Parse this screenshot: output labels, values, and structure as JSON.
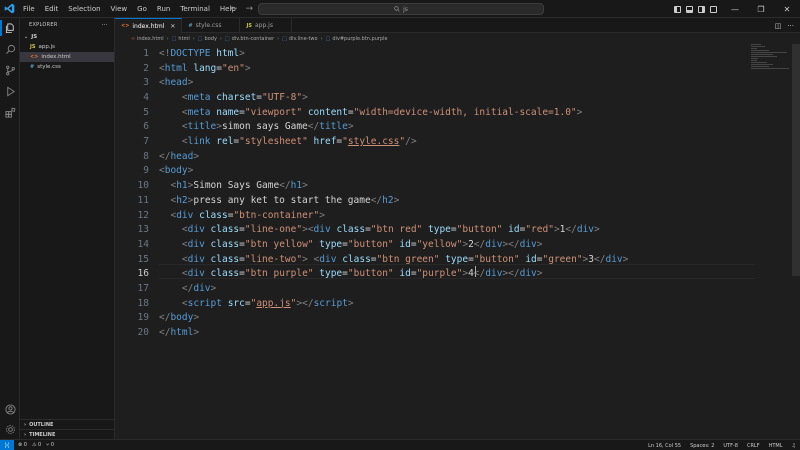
{
  "titlebar": {
    "menu": [
      "File",
      "Edit",
      "Selection",
      "View",
      "Go",
      "Run",
      "Terminal",
      "Help"
    ],
    "search_text": "js",
    "win_minimize": "—",
    "win_maximize": "❐",
    "win_close": "✕"
  },
  "sidebar": {
    "header": "EXPLORER",
    "more": "···",
    "folder": "JS",
    "files": [
      {
        "name": "app.js",
        "badge": "JS"
      },
      {
        "name": "index.html",
        "badge": "<>"
      },
      {
        "name": "style.css",
        "badge": "#"
      }
    ],
    "outline": "OUTLINE",
    "timeline": "TIMELINE"
  },
  "tabs": [
    {
      "label": "index.html",
      "badge": "<>",
      "close": "✕"
    },
    {
      "label": "style.css",
      "badge": "#"
    },
    {
      "label": "app.js",
      "badge": "JS"
    }
  ],
  "breadcrumb": [
    "index.html",
    "html",
    "body",
    "div.btn-container",
    "div.line-two",
    "div#purple.btn.purple"
  ],
  "editor": {
    "line_numbers": [
      "1",
      "2",
      "3",
      "4",
      "5",
      "6",
      "7",
      "8",
      "9",
      "10",
      "11",
      "12",
      "13",
      "14",
      "15",
      "16",
      "17",
      "18",
      "19",
      "20"
    ],
    "current_line": 16
  },
  "statusbar": {
    "errors": "⊗ 0",
    "warnings": "⚠ 0",
    "ports": "⑂ 0",
    "position": "Ln 16, Col 55",
    "spaces": "Spaces: 2",
    "encoding": "UTF-8",
    "eol": "CRLF",
    "language": "HTML",
    "bell": "🔔"
  },
  "colors": {
    "accent": "#0078d4",
    "tag": "#569cd6",
    "attribute": "#9cdcfe",
    "string": "#ce9178",
    "text": "#d4d4d4"
  },
  "icons": [
    "vscode-logo-icon",
    "files-icon",
    "search-icon",
    "source-control-icon",
    "run-debug-icon",
    "extensions-icon",
    "account-icon",
    "gear-icon"
  ]
}
